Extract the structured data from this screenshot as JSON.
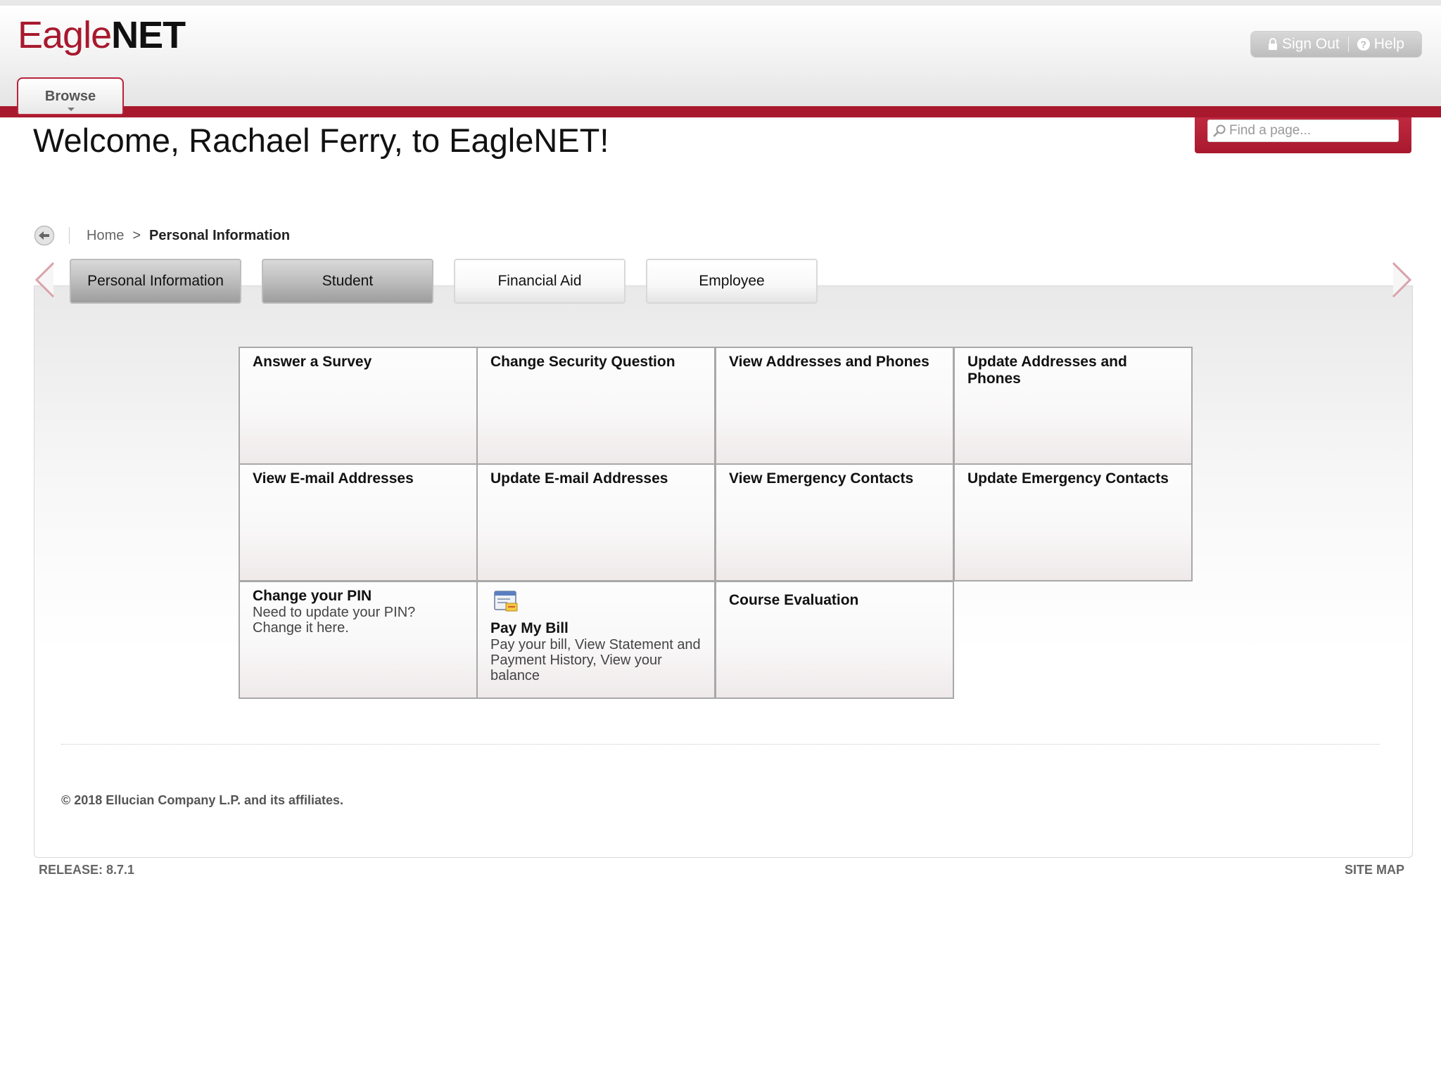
{
  "header": {
    "logo_part1": "Eagle",
    "logo_part2": "NET",
    "sign_out_label": "Sign Out",
    "help_label": "Help",
    "browse_label": "Browse",
    "search_placeholder": "Find a page..."
  },
  "welcome": "Welcome, Rachael Ferry, to EagleNET!",
  "breadcrumb": {
    "home": "Home",
    "separator": ">",
    "current": "Personal Information"
  },
  "tabs": [
    {
      "label": "Personal Information",
      "style": "dark"
    },
    {
      "label": "Student",
      "style": "dark"
    },
    {
      "label": "Financial Aid",
      "style": "light"
    },
    {
      "label": "Employee",
      "style": "light"
    }
  ],
  "cards": [
    {
      "title": "Answer a Survey",
      "desc": ""
    },
    {
      "title": "Change Security Question",
      "desc": ""
    },
    {
      "title": "View Addresses and Phones",
      "desc": ""
    },
    {
      "title": "Update Addresses and Phones",
      "desc": ""
    },
    {
      "title": "View E-mail Addresses",
      "desc": ""
    },
    {
      "title": "Update E-mail Addresses",
      "desc": ""
    },
    {
      "title": "View Emergency Contacts",
      "desc": ""
    },
    {
      "title": "Update Emergency Contacts",
      "desc": ""
    },
    {
      "title": "Change your PIN",
      "desc": "Need to update your PIN? Change it here."
    },
    {
      "title": "Pay My Bill",
      "desc": "Pay your bill, View Statement and Payment History, View your balance",
      "icon": "bill-icon"
    },
    {
      "title": "Course Evaluation",
      "desc": ""
    }
  ],
  "footer": {
    "copyright": "© 2018 Ellucian Company L.P. and its affiliates.",
    "release": "RELEASE: 8.7.1",
    "sitemap": "SITE MAP"
  },
  "colors": {
    "brand_red": "#a8192e",
    "tab_dark": "#bdbdbd",
    "card_border": "#a8a8a8"
  }
}
